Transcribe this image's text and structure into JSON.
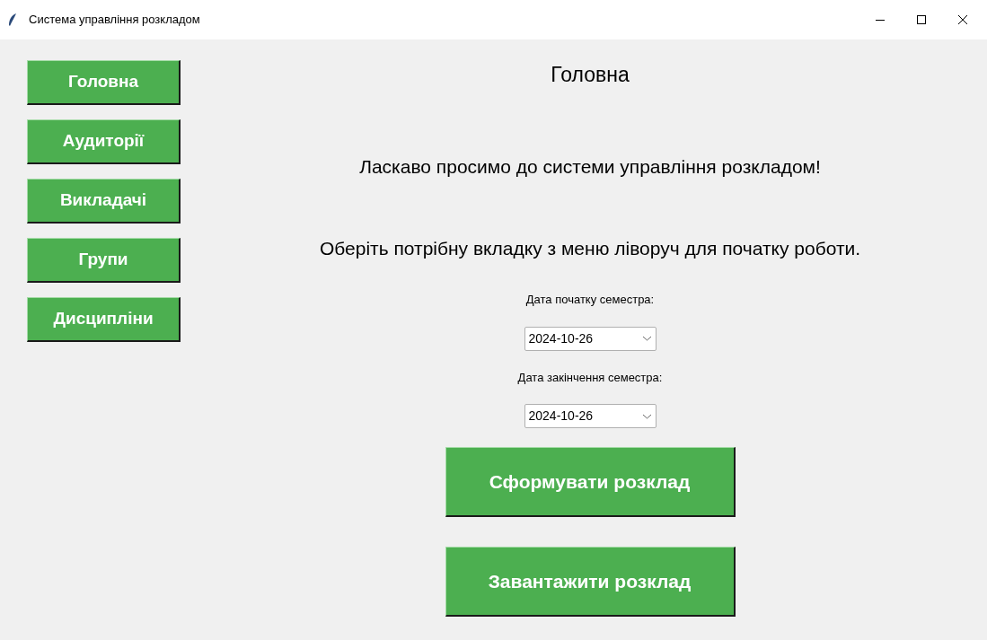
{
  "window": {
    "title": "Система управління розкладом"
  },
  "sidebar": {
    "items": [
      {
        "label": "Головна"
      },
      {
        "label": "Аудиторії"
      },
      {
        "label": "Викладачі"
      },
      {
        "label": "Групи"
      },
      {
        "label": "Дисципліни"
      }
    ]
  },
  "main": {
    "heading": "Головна",
    "welcome": "Ласкаво просимо до системи управління розкладом!",
    "hint": "Оберіть потрібну вкладку з меню ліворуч для початку роботи.",
    "fields": [
      {
        "label": "Дата початку семестра:",
        "value": "2024-10-26"
      },
      {
        "label": "Дата закінчення семестра:",
        "value": "2024-10-26"
      }
    ],
    "buttons": [
      "Сформувати розклад",
      "Завантажити розклад"
    ]
  }
}
